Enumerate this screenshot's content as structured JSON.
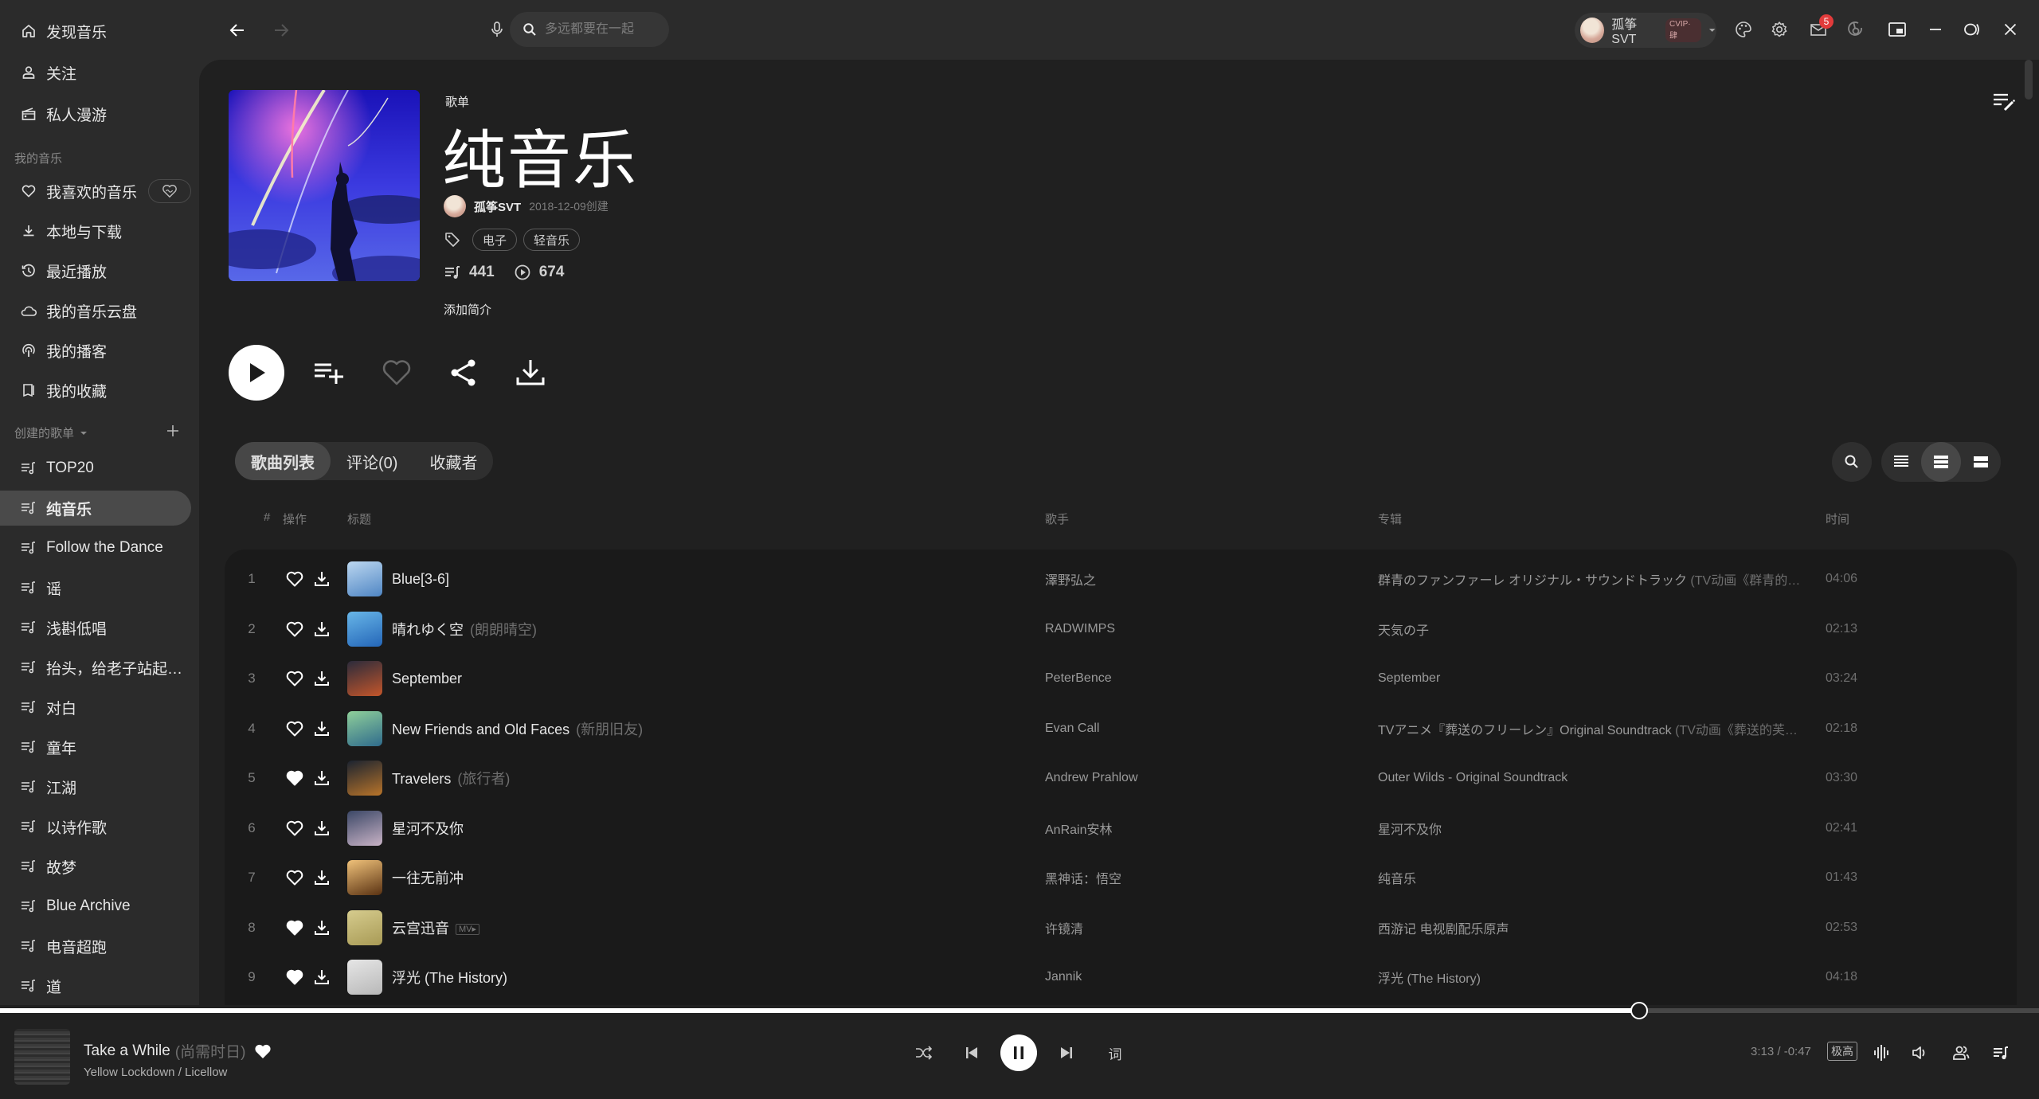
{
  "sidebar": {
    "top_items": [
      {
        "label": "发现音乐",
        "icon": "home-icon"
      },
      {
        "label": "关注",
        "icon": "user-icon"
      },
      {
        "label": "私人漫游",
        "icon": "radio-icon"
      }
    ],
    "my_music_label": "我的音乐",
    "my_music_items": [
      {
        "label": "我喜欢的音乐",
        "icon": "heart-icon"
      },
      {
        "label": "本地与下载",
        "icon": "download-icon"
      },
      {
        "label": "最近播放",
        "icon": "history-icon"
      },
      {
        "label": "我的音乐云盘",
        "icon": "cloud-icon"
      },
      {
        "label": "我的播客",
        "icon": "podcast-icon"
      },
      {
        "label": "我的收藏",
        "icon": "bookmark-icon"
      }
    ],
    "created_label": "创建的歌单",
    "playlists": [
      {
        "label": "TOP20"
      },
      {
        "label": "纯音乐",
        "active": true
      },
      {
        "label": "Follow the Dance"
      },
      {
        "label": "谣"
      },
      {
        "label": "浅斟低唱"
      },
      {
        "label": "抬头，给老子站起…"
      },
      {
        "label": "对白"
      },
      {
        "label": "童年"
      },
      {
        "label": "江湖"
      },
      {
        "label": "以诗作歌"
      },
      {
        "label": "故梦"
      },
      {
        "label": "Blue Archive"
      },
      {
        "label": "电音超跑"
      },
      {
        "label": "道"
      }
    ]
  },
  "topbar": {
    "search_placeholder": "多远都要在一起",
    "user_name": "孤筝SVT",
    "vip_label": "CVIP·肆",
    "mail_badge": "5"
  },
  "playlist": {
    "type_label": "歌单",
    "title": "纯音乐",
    "creator": "孤筝SVT",
    "created": "2018-12-09创建",
    "tags": [
      "电子",
      "轻音乐"
    ],
    "song_count": "441",
    "play_count": "674",
    "add_desc": "添加简介"
  },
  "tabs": [
    {
      "label": "歌曲列表",
      "active": true
    },
    {
      "label": "评论(0)"
    },
    {
      "label": "收藏者"
    }
  ],
  "columns": {
    "index": "#",
    "actions": "操作",
    "title": "标题",
    "artist": "歌手",
    "album": "专辑",
    "duration": "时间"
  },
  "songs": [
    {
      "index": "1",
      "title": "Blue[3-6]",
      "alias": "",
      "liked": false,
      "mv": false,
      "artist": "澤野弘之",
      "album": "群青のファンファーレ オリジナル・サウンドトラック",
      "album_alias": " (TV动画《群青的…",
      "duration": "04:06",
      "thumb": [
        "#bcd7f0",
        "#4f86c4"
      ]
    },
    {
      "index": "2",
      "title": "晴れゆく空",
      "alias": "(朗朗晴空)",
      "liked": false,
      "mv": false,
      "artist": "RADWIMPS",
      "album": "天気の子",
      "album_alias": "",
      "duration": "02:13",
      "thumb": [
        "#68b6e8",
        "#2466b8"
      ]
    },
    {
      "index": "3",
      "title": "September",
      "alias": "",
      "liked": false,
      "mv": false,
      "artist": "PeterBence",
      "album": "September",
      "album_alias": "",
      "duration": "03:24",
      "thumb": [
        "#2b2b3b",
        "#c4562b"
      ]
    },
    {
      "index": "4",
      "title": "New Friends and Old Faces",
      "alias": "(新朋旧友)",
      "liked": false,
      "mv": false,
      "artist": "Evan Call",
      "album": "TVアニメ『葬送のフリーレン』Original Soundtrack",
      "album_alias": " (TV动画《葬送的芙…",
      "duration": "02:18",
      "thumb": [
        "#8fcf9a",
        "#2f6b8c"
      ]
    },
    {
      "index": "5",
      "title": "Travelers",
      "alias": "(旅行者)",
      "liked": true,
      "mv": false,
      "artist": "Andrew Prahlow",
      "album": "Outer Wilds - Original Soundtrack",
      "album_alias": "",
      "duration": "03:30",
      "thumb": [
        "#1b2330",
        "#b8742a"
      ]
    },
    {
      "index": "6",
      "title": "星河不及你",
      "alias": "",
      "liked": false,
      "mv": false,
      "artist": "AnRain安林",
      "album": "星河不及你",
      "album_alias": "",
      "duration": "02:41",
      "thumb": [
        "#3b4766",
        "#c9b3c6"
      ]
    },
    {
      "index": "7",
      "title": "一往无前冲",
      "alias": "",
      "liked": false,
      "mv": false,
      "artist": "黑神话：悟空",
      "album": "纯音乐",
      "album_alias": "",
      "duration": "01:43",
      "thumb": [
        "#f0c27a",
        "#5a3212"
      ]
    },
    {
      "index": "8",
      "title": "云宫迅音",
      "alias": "",
      "liked": true,
      "mv": true,
      "mv_label": "MV▸",
      "artist": "许镜清",
      "album": "西游记 电视剧配乐原声",
      "album_alias": "",
      "duration": "02:53",
      "thumb": [
        "#d6cc8e",
        "#a89a55"
      ]
    },
    {
      "index": "9",
      "title": "浮光 (The History)",
      "alias": "",
      "liked": true,
      "mv": false,
      "artist": "Jannik",
      "album": "浮光 (The History)",
      "album_alias": "",
      "duration": "04:18",
      "thumb": [
        "#e6e6e6",
        "#b8b8b8"
      ]
    }
  ],
  "player": {
    "title": "Take a While",
    "alias": "(尚需时日)",
    "artist": "Yellow Lockdown / Licellow",
    "liked": true,
    "elapsed": "3:13",
    "remaining": "-0:47",
    "time_readout": "3:13 / -0:47",
    "progress": 0.804,
    "quality": "极高",
    "lyrics_label": "词"
  },
  "colors": {
    "accent": "#ffffff",
    "sidebar_bg": "#2b2b2b",
    "main_bg": "#202020",
    "table_bg": "#1a1a1a",
    "badge": "#e23b3b"
  }
}
